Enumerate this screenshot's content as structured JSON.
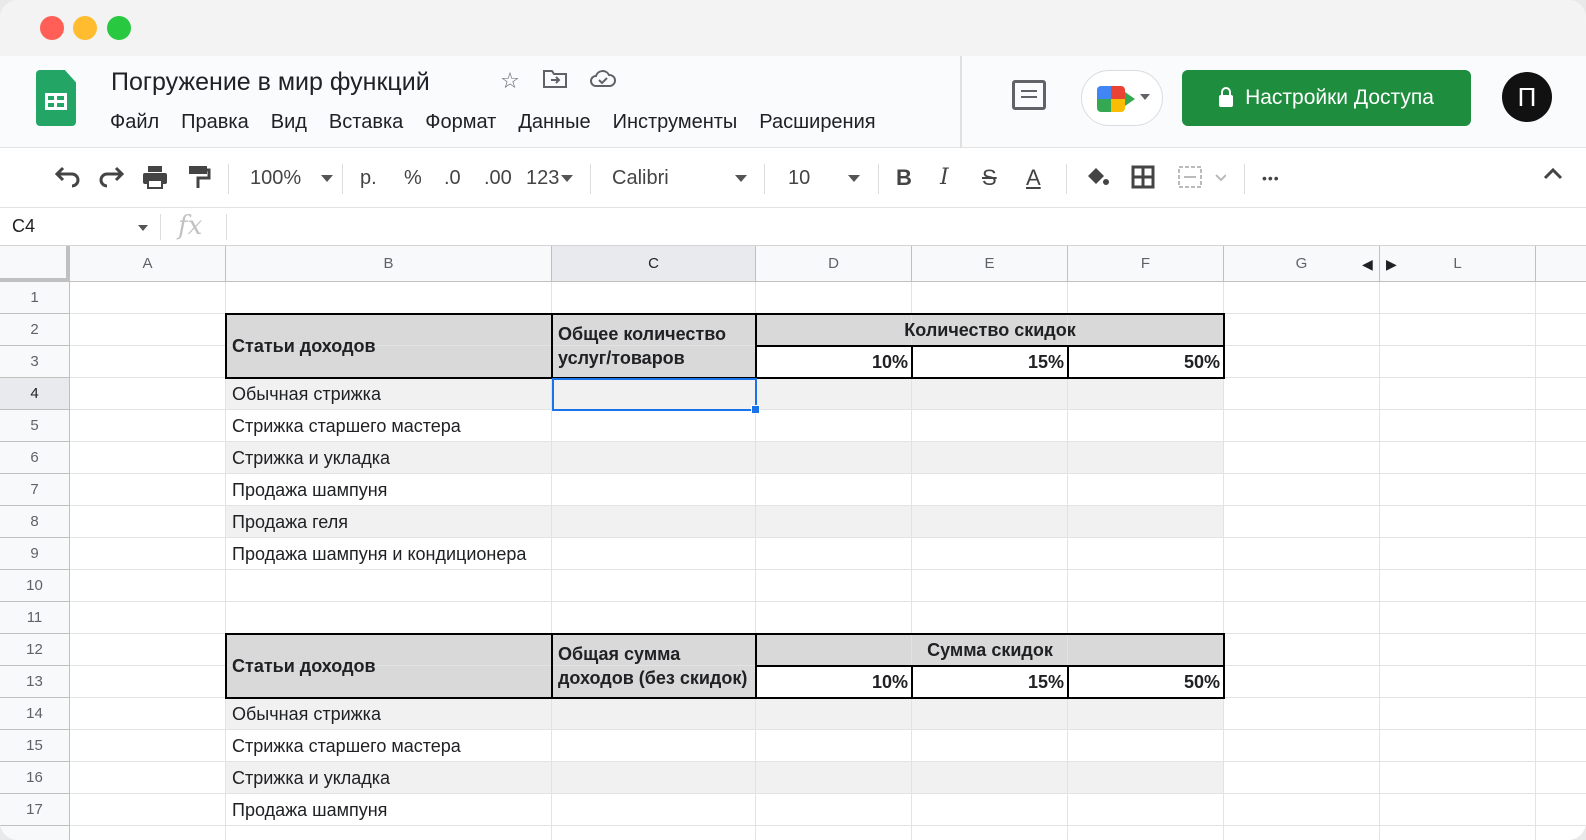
{
  "app": {
    "doc_title": "Погружение в мир функций",
    "menu": [
      "Файл",
      "Правка",
      "Вид",
      "Вставка",
      "Формат",
      "Данные",
      "Инструменты",
      "Расширения"
    ],
    "share_label": "Настройки Доступа",
    "avatar_letter": "П",
    "brand_color": "#1e8e3e"
  },
  "toolbar": {
    "zoom": "100%",
    "currency": "р.",
    "percent": "%",
    "dec_decrease": ".0",
    "dec_increase": ".00",
    "number_format": "123",
    "font": "Calibri",
    "font_size": "10",
    "bold": "B",
    "italic": "I",
    "strike": "S",
    "text_color": "A",
    "more": "•••"
  },
  "formula_bar": {
    "cell_ref": "C4",
    "fx": "fx",
    "value": ""
  },
  "columns": [
    "A",
    "B",
    "C",
    "D",
    "E",
    "F",
    "G",
    "L"
  ],
  "rows": [
    "1",
    "2",
    "3",
    "4",
    "5",
    "6",
    "7",
    "8",
    "9",
    "10",
    "11",
    "12",
    "13",
    "14",
    "15",
    "16",
    "17"
  ],
  "table1": {
    "col_b_header": "Статьи доходов",
    "col_c_header_line1": "Общее количество",
    "col_c_header_line2": "услуг/товаров",
    "group_header": "Количество скидок",
    "discounts": [
      "10%",
      "15%",
      "50%"
    ],
    "items": [
      "Обычная стрижка",
      "Стрижка старшего мастера",
      "Стрижка и укладка",
      "Продажа шампуня",
      "Продажа геля",
      "Продажа шампуня и кондиционера"
    ]
  },
  "table2": {
    "col_b_header": "Статьи доходов",
    "col_c_header_line1": "Общая сумма",
    "col_c_header_line2": "доходов (без скидок)",
    "group_header": "Сумма скидок",
    "discounts": [
      "10%",
      "15%",
      "50%"
    ],
    "items": [
      "Обычная стрижка",
      "Стрижка старшего мастера",
      "Стрижка и укладка",
      "Продажа шампуня"
    ]
  },
  "selected_cell": "C4"
}
